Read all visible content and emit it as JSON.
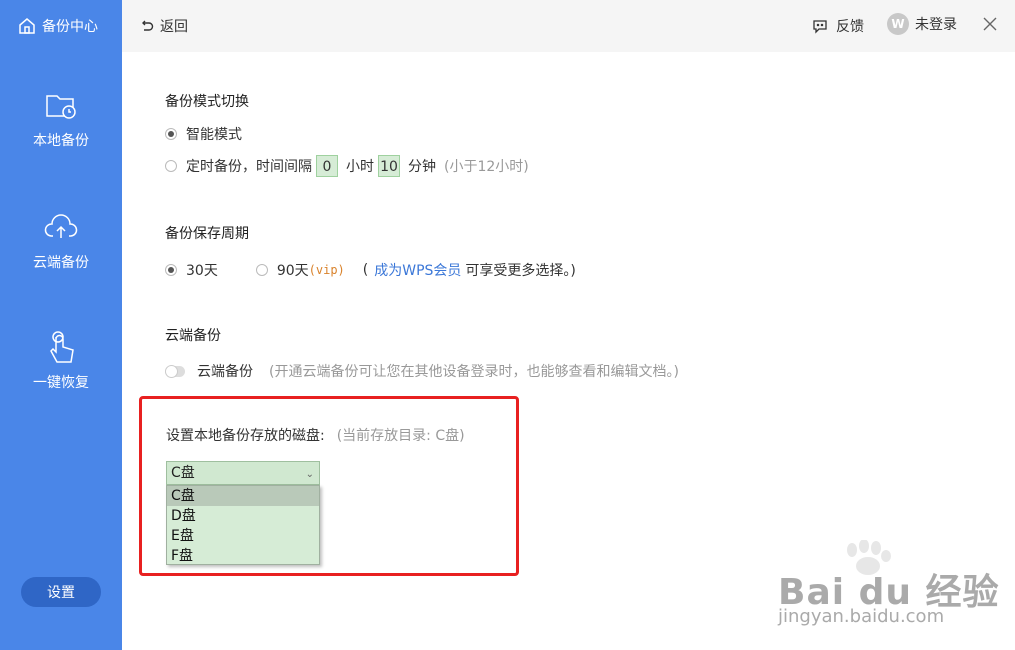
{
  "sidebar": {
    "brand": "备份中心",
    "items": [
      {
        "label": "本地备份",
        "icon": "folder-clock-icon"
      },
      {
        "label": "云端备份",
        "icon": "cloud-upload-icon"
      },
      {
        "label": "一键恢复",
        "icon": "hand-tap-icon"
      }
    ],
    "settings": "设置"
  },
  "topbar": {
    "back": "返回",
    "feedback": "反馈",
    "avatar_letter": "W",
    "login": "未登录"
  },
  "mode": {
    "title": "备份模式切换",
    "smart": "智能模式",
    "timed_prefix": "定时备份，时间间隔",
    "hours": "0",
    "hours_unit": "小时",
    "minutes": "10",
    "minutes_unit": "分钟",
    "hint": "(小于12小时)",
    "selected": "smart"
  },
  "period": {
    "title": "备份保存周期",
    "opt1": "30天",
    "opt2": "90天",
    "vip": "(vip)",
    "note_open": "(",
    "link": "成为WPS会员",
    "note_rest": "可享受更多选择。)",
    "selected": "30天"
  },
  "cloud": {
    "title": "云端备份",
    "toggle_label": "云端备份",
    "hint": "(开通云端备份可让您在其他设备登录时，也能够查看和编辑文档。)",
    "enabled": false
  },
  "disk": {
    "label": "设置本地备份存放的磁盘:",
    "current": "(当前存放目录: C盘)",
    "selected": "C盘",
    "options": [
      "C盘",
      "D盘",
      "E盘",
      "F盘"
    ]
  },
  "watermark": {
    "brand": "Bai du 经验",
    "url": "jingyan.baidu.com"
  }
}
